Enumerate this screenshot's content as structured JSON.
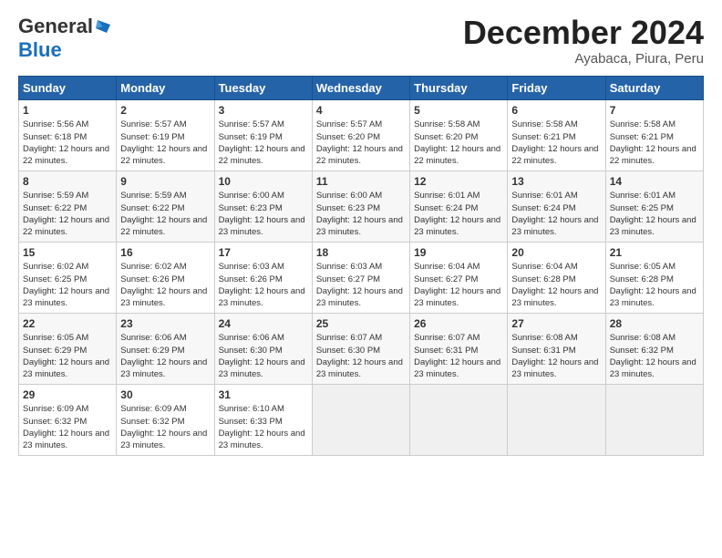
{
  "header": {
    "logo_general": "General",
    "logo_blue": "Blue",
    "month_title": "December 2024",
    "location": "Ayabaca, Piura, Peru"
  },
  "days_of_week": [
    "Sunday",
    "Monday",
    "Tuesday",
    "Wednesday",
    "Thursday",
    "Friday",
    "Saturday"
  ],
  "weeks": [
    [
      {
        "day": "1",
        "sunrise": "Sunrise: 5:56 AM",
        "sunset": "Sunset: 6:18 PM",
        "daylight": "Daylight: 12 hours and 22 minutes."
      },
      {
        "day": "2",
        "sunrise": "Sunrise: 5:57 AM",
        "sunset": "Sunset: 6:19 PM",
        "daylight": "Daylight: 12 hours and 22 minutes."
      },
      {
        "day": "3",
        "sunrise": "Sunrise: 5:57 AM",
        "sunset": "Sunset: 6:19 PM",
        "daylight": "Daylight: 12 hours and 22 minutes."
      },
      {
        "day": "4",
        "sunrise": "Sunrise: 5:57 AM",
        "sunset": "Sunset: 6:20 PM",
        "daylight": "Daylight: 12 hours and 22 minutes."
      },
      {
        "day": "5",
        "sunrise": "Sunrise: 5:58 AM",
        "sunset": "Sunset: 6:20 PM",
        "daylight": "Daylight: 12 hours and 22 minutes."
      },
      {
        "day": "6",
        "sunrise": "Sunrise: 5:58 AM",
        "sunset": "Sunset: 6:21 PM",
        "daylight": "Daylight: 12 hours and 22 minutes."
      },
      {
        "day": "7",
        "sunrise": "Sunrise: 5:58 AM",
        "sunset": "Sunset: 6:21 PM",
        "daylight": "Daylight: 12 hours and 22 minutes."
      }
    ],
    [
      {
        "day": "8",
        "sunrise": "Sunrise: 5:59 AM",
        "sunset": "Sunset: 6:22 PM",
        "daylight": "Daylight: 12 hours and 22 minutes."
      },
      {
        "day": "9",
        "sunrise": "Sunrise: 5:59 AM",
        "sunset": "Sunset: 6:22 PM",
        "daylight": "Daylight: 12 hours and 22 minutes."
      },
      {
        "day": "10",
        "sunrise": "Sunrise: 6:00 AM",
        "sunset": "Sunset: 6:23 PM",
        "daylight": "Daylight: 12 hours and 23 minutes."
      },
      {
        "day": "11",
        "sunrise": "Sunrise: 6:00 AM",
        "sunset": "Sunset: 6:23 PM",
        "daylight": "Daylight: 12 hours and 23 minutes."
      },
      {
        "day": "12",
        "sunrise": "Sunrise: 6:01 AM",
        "sunset": "Sunset: 6:24 PM",
        "daylight": "Daylight: 12 hours and 23 minutes."
      },
      {
        "day": "13",
        "sunrise": "Sunrise: 6:01 AM",
        "sunset": "Sunset: 6:24 PM",
        "daylight": "Daylight: 12 hours and 23 minutes."
      },
      {
        "day": "14",
        "sunrise": "Sunrise: 6:01 AM",
        "sunset": "Sunset: 6:25 PM",
        "daylight": "Daylight: 12 hours and 23 minutes."
      }
    ],
    [
      {
        "day": "15",
        "sunrise": "Sunrise: 6:02 AM",
        "sunset": "Sunset: 6:25 PM",
        "daylight": "Daylight: 12 hours and 23 minutes."
      },
      {
        "day": "16",
        "sunrise": "Sunrise: 6:02 AM",
        "sunset": "Sunset: 6:26 PM",
        "daylight": "Daylight: 12 hours and 23 minutes."
      },
      {
        "day": "17",
        "sunrise": "Sunrise: 6:03 AM",
        "sunset": "Sunset: 6:26 PM",
        "daylight": "Daylight: 12 hours and 23 minutes."
      },
      {
        "day": "18",
        "sunrise": "Sunrise: 6:03 AM",
        "sunset": "Sunset: 6:27 PM",
        "daylight": "Daylight: 12 hours and 23 minutes."
      },
      {
        "day": "19",
        "sunrise": "Sunrise: 6:04 AM",
        "sunset": "Sunset: 6:27 PM",
        "daylight": "Daylight: 12 hours and 23 minutes."
      },
      {
        "day": "20",
        "sunrise": "Sunrise: 6:04 AM",
        "sunset": "Sunset: 6:28 PM",
        "daylight": "Daylight: 12 hours and 23 minutes."
      },
      {
        "day": "21",
        "sunrise": "Sunrise: 6:05 AM",
        "sunset": "Sunset: 6:28 PM",
        "daylight": "Daylight: 12 hours and 23 minutes."
      }
    ],
    [
      {
        "day": "22",
        "sunrise": "Sunrise: 6:05 AM",
        "sunset": "Sunset: 6:29 PM",
        "daylight": "Daylight: 12 hours and 23 minutes."
      },
      {
        "day": "23",
        "sunrise": "Sunrise: 6:06 AM",
        "sunset": "Sunset: 6:29 PM",
        "daylight": "Daylight: 12 hours and 23 minutes."
      },
      {
        "day": "24",
        "sunrise": "Sunrise: 6:06 AM",
        "sunset": "Sunset: 6:30 PM",
        "daylight": "Daylight: 12 hours and 23 minutes."
      },
      {
        "day": "25",
        "sunrise": "Sunrise: 6:07 AM",
        "sunset": "Sunset: 6:30 PM",
        "daylight": "Daylight: 12 hours and 23 minutes."
      },
      {
        "day": "26",
        "sunrise": "Sunrise: 6:07 AM",
        "sunset": "Sunset: 6:31 PM",
        "daylight": "Daylight: 12 hours and 23 minutes."
      },
      {
        "day": "27",
        "sunrise": "Sunrise: 6:08 AM",
        "sunset": "Sunset: 6:31 PM",
        "daylight": "Daylight: 12 hours and 23 minutes."
      },
      {
        "day": "28",
        "sunrise": "Sunrise: 6:08 AM",
        "sunset": "Sunset: 6:32 PM",
        "daylight": "Daylight: 12 hours and 23 minutes."
      }
    ],
    [
      {
        "day": "29",
        "sunrise": "Sunrise: 6:09 AM",
        "sunset": "Sunset: 6:32 PM",
        "daylight": "Daylight: 12 hours and 23 minutes."
      },
      {
        "day": "30",
        "sunrise": "Sunrise: 6:09 AM",
        "sunset": "Sunset: 6:32 PM",
        "daylight": "Daylight: 12 hours and 23 minutes."
      },
      {
        "day": "31",
        "sunrise": "Sunrise: 6:10 AM",
        "sunset": "Sunset: 6:33 PM",
        "daylight": "Daylight: 12 hours and 23 minutes."
      },
      null,
      null,
      null,
      null
    ]
  ]
}
